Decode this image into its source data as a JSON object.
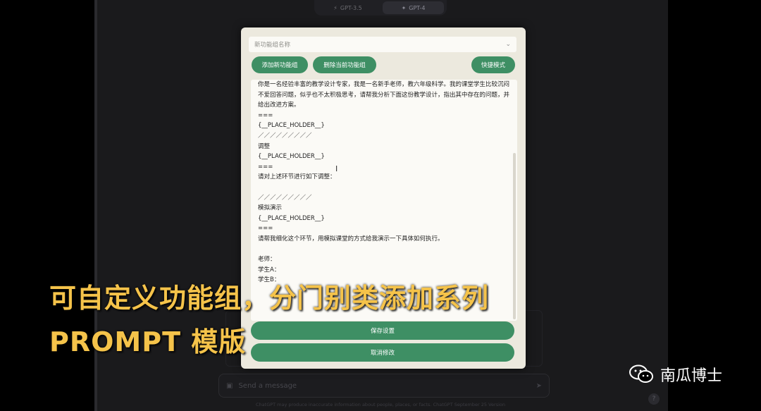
{
  "background": {
    "models": [
      {
        "label": "GPT-3.5",
        "icon": "lightning-icon"
      },
      {
        "label": "GPT-4",
        "icon": "sparkle-icon"
      }
    ],
    "input_placeholder": "Send a message",
    "footer": "ChatGPT may produce inaccurate information about people, places, or facts. ChatGPT September 25 Version",
    "help": "?"
  },
  "modal": {
    "group_select_placeholder": "新功能组名称",
    "buttons": {
      "add_group": "添加新功能组",
      "delete_group": "删除当前功能组",
      "quick_mode": "快捷模式",
      "save": "保存设置",
      "cancel": "取消修改"
    },
    "prompt_text": "你是一名经验丰富的教学设计专家，我是一名新手老师，教六年级科学。我的课堂学生比较沉闷不爱回答问题，似乎也不太积极思考，请帮我分析下面这份教学设计，指出其中存在的问题，并给出改进方案。\n===\n{__PLACE_HOLDER__}\n／／／／／／／／／\n调整\n{__PLACE_HOLDER__}\n===\n请对上述环节进行如下调整：\n\n／／／／／／／／／\n模拟演示\n{__PLACE_HOLDER__}\n===\n请帮我细化这个环节，用模拟课堂的方式给我演示一下具体如何执行。\n\n老师：\n学生A：\n学生B："
  },
  "caption": {
    "line1": "可自定义功能组，分门别类添加系列",
    "line2": "PROMPT 模版"
  },
  "watermark": {
    "text": "南瓜博士",
    "icon": "wechat-icon"
  },
  "colors": {
    "accent_green": "#3e8f64",
    "caption_yellow": "#f5c34a",
    "modal_bg": "#ece9de"
  }
}
